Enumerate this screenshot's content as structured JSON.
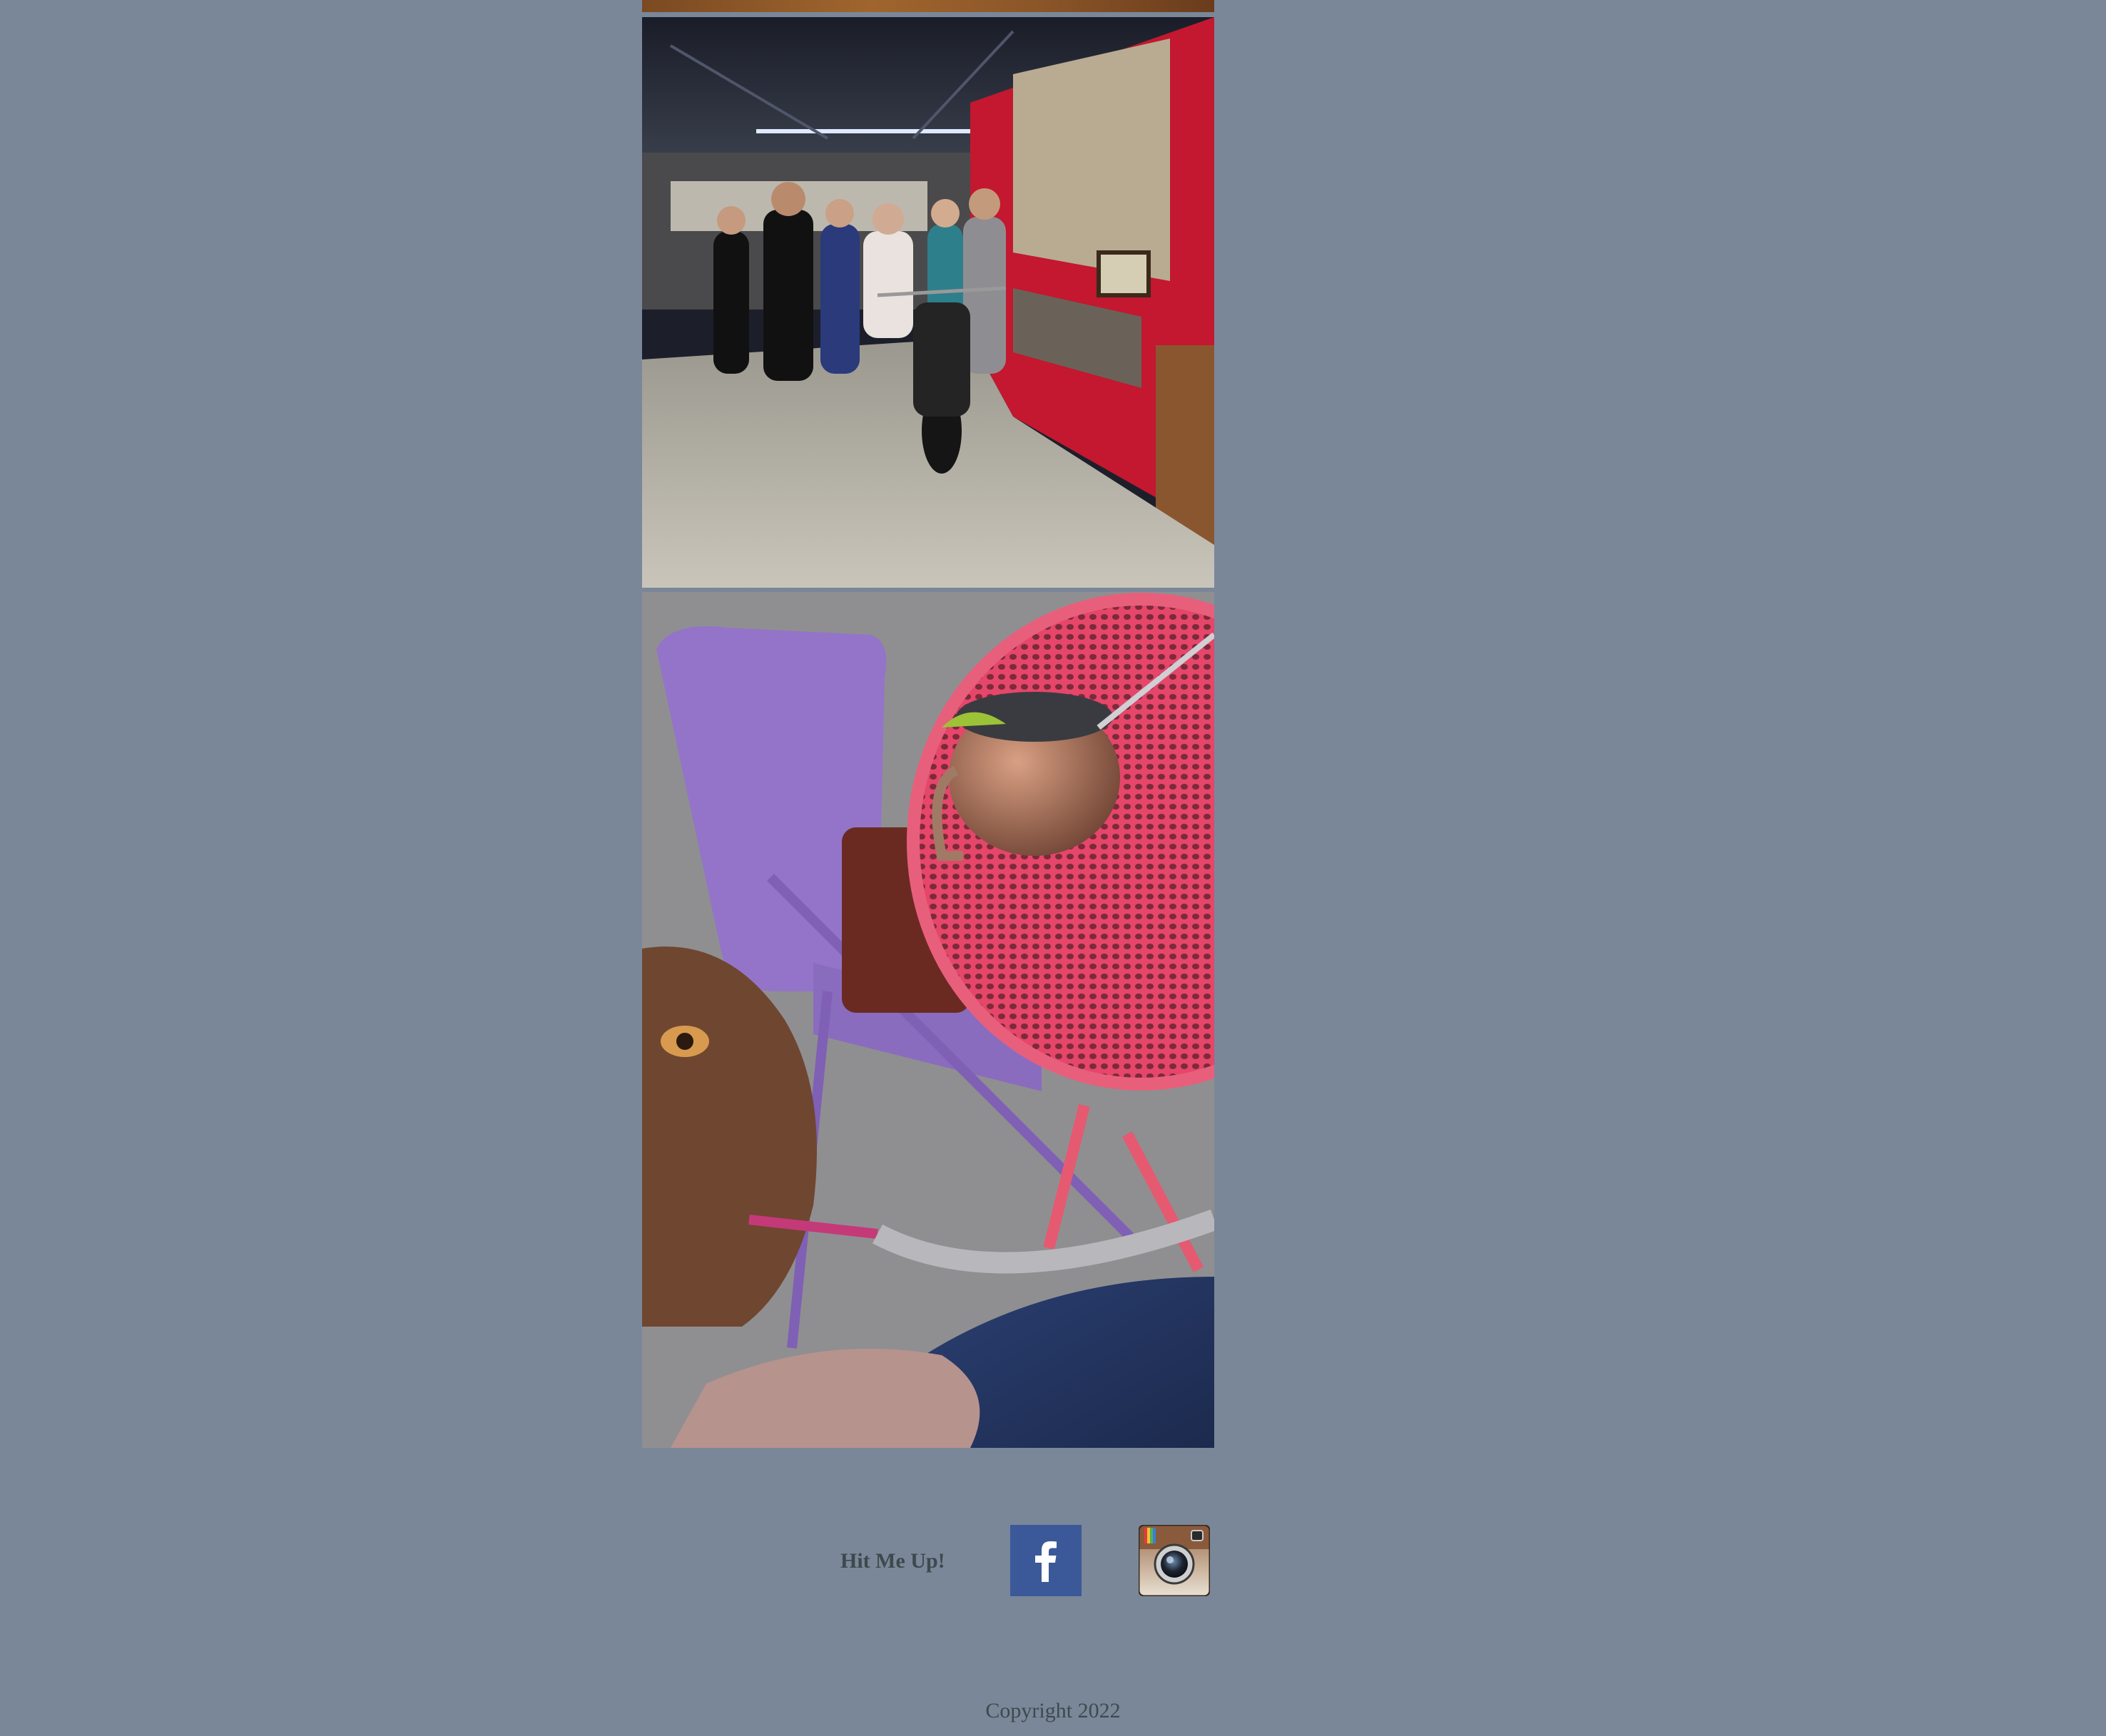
{
  "gallery": {
    "images": [
      {
        "name": "photo-top",
        "description": ""
      },
      {
        "name": "photo-group-motorcycle",
        "description": ""
      },
      {
        "name": "photo-dog-table",
        "description": ""
      }
    ]
  },
  "footer": {
    "contact_label": "Hit Me Up!",
    "social": [
      {
        "name": "facebook",
        "icon": "facebook-icon",
        "color": "#3b5998"
      },
      {
        "name": "instagram",
        "icon": "instagram-icon",
        "color": "#8a5a3c"
      }
    ],
    "copyright": "Copyright 2022"
  },
  "colors": {
    "page_background": "#7a8799",
    "footer_text": "#3c4a4d"
  }
}
